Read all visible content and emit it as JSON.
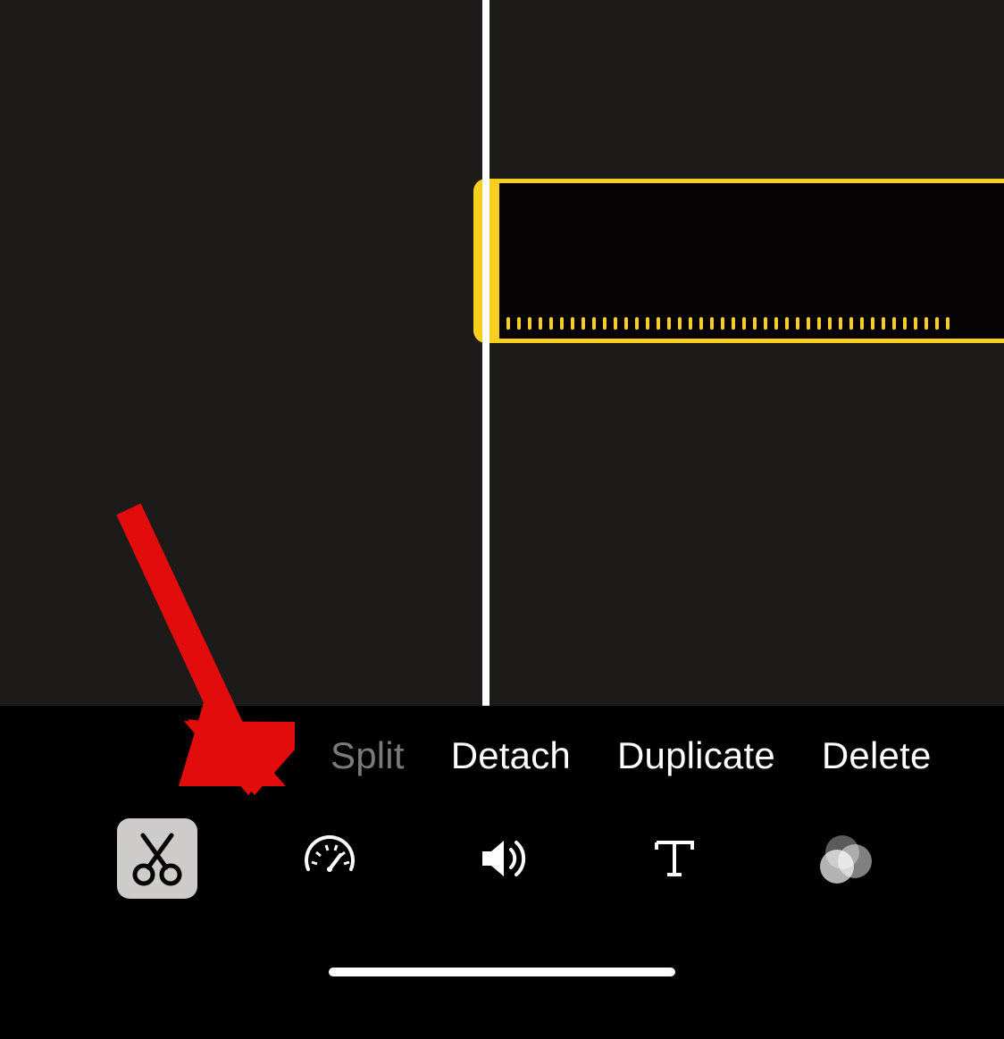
{
  "timeline": {
    "clip_selected": true,
    "tick_count": 42
  },
  "actions": {
    "split": {
      "label": "Split",
      "enabled": false
    },
    "detach": {
      "label": "Detach",
      "enabled": true
    },
    "duplicate": {
      "label": "Duplicate",
      "enabled": true
    },
    "delete": {
      "label": "Delete",
      "enabled": true
    }
  },
  "tools": {
    "active": "actions",
    "items": {
      "actions": {
        "icon": "scissors-icon",
        "selected": true
      },
      "speed": {
        "icon": "speedometer-icon",
        "selected": false
      },
      "volume": {
        "icon": "speaker-icon",
        "selected": false
      },
      "titles": {
        "icon": "text-icon",
        "selected": false
      },
      "filters": {
        "icon": "filters-icon",
        "selected": false
      }
    }
  },
  "colors": {
    "accent": "#f9cf1e",
    "annotation_arrow": "#e30c0c"
  }
}
